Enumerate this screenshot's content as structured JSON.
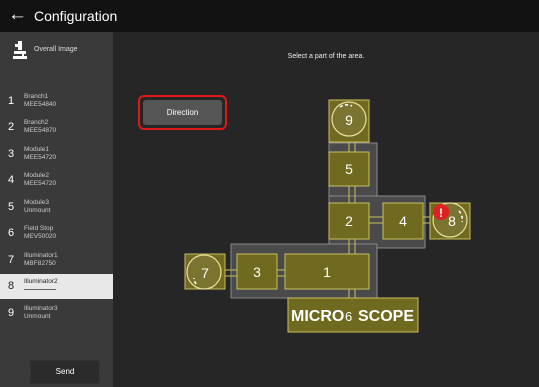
{
  "header": {
    "back_icon": "back-arrow-icon",
    "title": "Configuration"
  },
  "sidebar": {
    "overall_label": "Overall Image",
    "items": [
      {
        "num": "1",
        "line1": "Branch1",
        "line2": "MEE54840"
      },
      {
        "num": "2",
        "line1": "Branch2",
        "line2": "MEE54870"
      },
      {
        "num": "3",
        "line1": "Module1",
        "line2": "MEE54720"
      },
      {
        "num": "4",
        "line1": "Module2",
        "line2": "MEE54720"
      },
      {
        "num": "5",
        "line1": "Module3",
        "line2": "Unmount"
      },
      {
        "num": "6",
        "line1": "Field Stop",
        "line2": "MEV50020"
      },
      {
        "num": "7",
        "line1": "Illuminator1",
        "line2": "MBF82750"
      },
      {
        "num": "8",
        "line1": "Illuminator2",
        "line2": ""
      },
      {
        "num": "9",
        "line1": "Illuminator3",
        "line2": "Unmount"
      }
    ],
    "selected_item": "8",
    "send_label": "Send"
  },
  "main": {
    "hint": "Select a part of the area.",
    "direction_label": "Direction",
    "microscope_left": "MICRO",
    "microscope_center": "6",
    "microscope_right": "SCOPE",
    "parts": [
      "1",
      "2",
      "3",
      "4",
      "5",
      "7",
      "8",
      "9"
    ],
    "alert_mark": "!",
    "colors": {
      "part_fill": "#6f6a1f",
      "part_stroke": "#c8c060",
      "alert": "#e02020",
      "highlight": "#e01818"
    }
  }
}
